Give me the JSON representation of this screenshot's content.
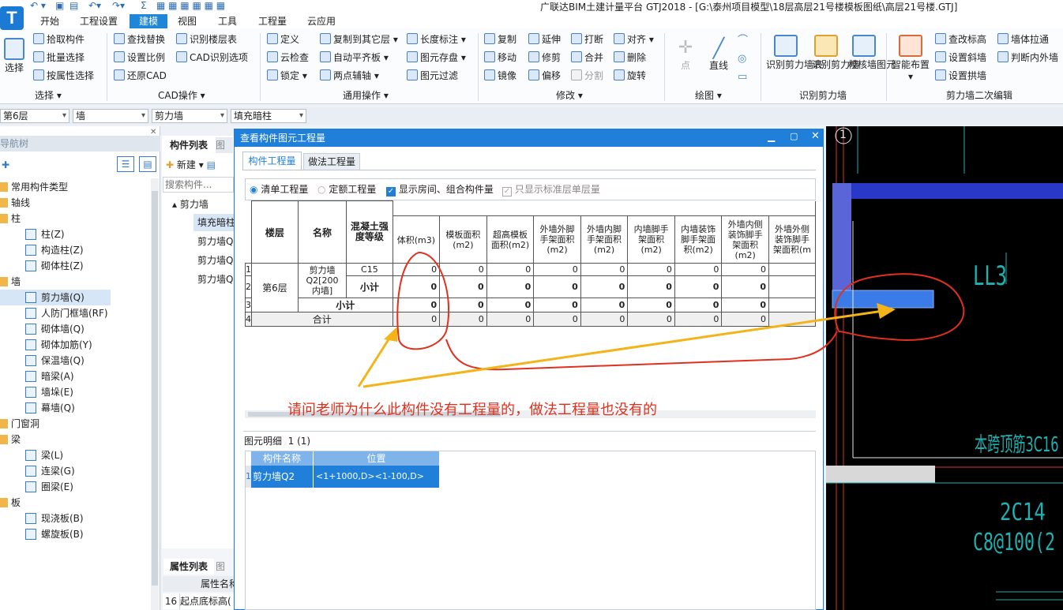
{
  "app": {
    "title": "广联达BIM土建计量平台 GTJ2018 - [G:\\泰州项目模型\\18层高层21号楼模板图纸\\高层21号楼.GTJ]",
    "logo": "T"
  },
  "menu": [
    "开始",
    "工程设置",
    "建模",
    "视图",
    "工具",
    "工程量",
    "云应用"
  ],
  "ribbon": {
    "select": {
      "big": "选择",
      "items": [
        "拾取构件",
        "批量选择",
        "按属性选择"
      ],
      "group": "选择"
    },
    "cad": {
      "items": [
        "查找替换",
        "识别楼层表",
        "设置比例",
        "CAD识别选项",
        "还原CAD"
      ],
      "group": "CAD操作"
    },
    "general": {
      "items": [
        "定义",
        "复制到其它层",
        "长度标注",
        "云检查",
        "自动平齐板",
        "图元存盘",
        "锁定",
        "两点辅轴",
        "图元过滤"
      ],
      "group": "通用操作"
    },
    "modify": {
      "items": [
        "复制",
        "延伸",
        "打断",
        "对齐",
        "移动",
        "修剪",
        "合并",
        "删除",
        "镜像",
        "偏移",
        "分割",
        "旋转"
      ],
      "group": "修改"
    },
    "draw": {
      "items": [
        "点",
        "直线"
      ],
      "group": "绘图"
    },
    "recog": {
      "items": [
        "识别剪力墙表",
        "识别剪力墙",
        "校核墙图元"
      ],
      "group": "识别剪力墙"
    },
    "edit2": {
      "big": "智能布置",
      "items": [
        "查改标高",
        "墙体拉通",
        "设置斜墙",
        "判断内外墙",
        "设置拱墙"
      ],
      "group": "剪力墙二次编辑"
    }
  },
  "selectors": [
    "第6层",
    "墙",
    "剪力墙",
    "填充暗柱"
  ],
  "nav": {
    "title": "导航树",
    "items": [
      {
        "label": "常用构件类型",
        "level": 0
      },
      {
        "label": "轴线",
        "level": 0
      },
      {
        "label": "柱",
        "level": 0
      },
      {
        "label": "柱(Z)",
        "level": 1
      },
      {
        "label": "构造柱(Z)",
        "level": 1
      },
      {
        "label": "砌体柱(Z)",
        "level": 1
      },
      {
        "label": "墙",
        "level": 0
      },
      {
        "label": "剪力墙(Q)",
        "level": 1,
        "selected": true
      },
      {
        "label": "人防门框墙(RF)",
        "level": 1
      },
      {
        "label": "砌体墙(Q)",
        "level": 1
      },
      {
        "label": "砌体加筋(Y)",
        "level": 1
      },
      {
        "label": "保温墙(Q)",
        "level": 1
      },
      {
        "label": "暗梁(A)",
        "level": 1
      },
      {
        "label": "墙垛(E)",
        "level": 1
      },
      {
        "label": "幕墙(Q)",
        "level": 1
      },
      {
        "label": "门窗洞",
        "level": 0
      },
      {
        "label": "梁",
        "level": 0
      },
      {
        "label": "梁(L)",
        "level": 1
      },
      {
        "label": "连梁(G)",
        "level": 1
      },
      {
        "label": "圈梁(E)",
        "level": 1
      },
      {
        "label": "板",
        "level": 0
      },
      {
        "label": "现浇板(B)",
        "level": 1
      },
      {
        "label": "螺旋板(B)",
        "level": 1
      }
    ]
  },
  "complist": {
    "tabs": [
      "构件列表",
      "图"
    ],
    "new_label": "新建",
    "search_placeholder": "搜索构件...",
    "group": "剪力墙",
    "items": [
      "填充暗柱",
      "剪力墙Q",
      "剪力墙Q",
      "剪力墙Q"
    ],
    "props_tabs": [
      "属性列表",
      "图"
    ],
    "props_header": "属性名称",
    "props_row": {
      "num": "16",
      "name": "起点底标高("
    }
  },
  "dialog": {
    "title": "查看构件图元工程量",
    "tabs": [
      "构件工程量",
      "做法工程量"
    ],
    "options": {
      "qingdan": "清单工程量",
      "dinge": "定额工程量",
      "show_rooms": "显示房间、组合构件量",
      "only_std": "只显示标准层单层量"
    },
    "headers": [
      "楼层",
      "名称",
      "混凝土强度等级",
      "体积(m3)",
      "模板面积(m2)",
      "超高模板面积(m2)",
      "外墙外脚手架面积(m2)",
      "外墙内脚手架面积(m2)",
      "内墙脚手架面积(m2)",
      "内墙装饰脚手架面积(m2)",
      "外墙内侧装饰脚手架面积(m2)",
      "外墙外侧装饰脚手架面积(m"
    ],
    "row_nums": [
      "1",
      "2",
      "3",
      "4"
    ],
    "floor": "第6层",
    "name": "剪力墙Q2[200 内墙]",
    "grade": "C15",
    "subtotal": "小计",
    "total": "合计",
    "row1": [
      "0",
      "0",
      "0",
      "0",
      "0",
      "0",
      "0",
      "0"
    ],
    "row2": [
      "0",
      "0",
      "0",
      "0",
      "0",
      "0",
      "0",
      "0"
    ],
    "row3": [
      "0",
      "0",
      "0",
      "0",
      "0",
      "0",
      "0",
      "0"
    ],
    "row4": [
      "0",
      "0",
      "0",
      "0",
      "0",
      "0",
      "0",
      "0"
    ],
    "detail_title": "图元明细",
    "detail_count": "1 (1)",
    "detail_headers": [
      "构件名称",
      "位置"
    ],
    "detail_row": {
      "num": "1",
      "name": "剪力墙Q2",
      "pos": "<1+1000,D><1-100,D>"
    }
  },
  "annotation": "请问老师为什么此构件没有工程量的，做法工程量也没有的",
  "cad": {
    "axis": "1",
    "texts": [
      "LL3",
      "本跨顶筋3C16",
      "2C14",
      "C8@100(2"
    ]
  },
  "colors": {
    "accent": "#1f7fd9",
    "annotation": "#e0301e",
    "arrow": "#f2b418"
  }
}
